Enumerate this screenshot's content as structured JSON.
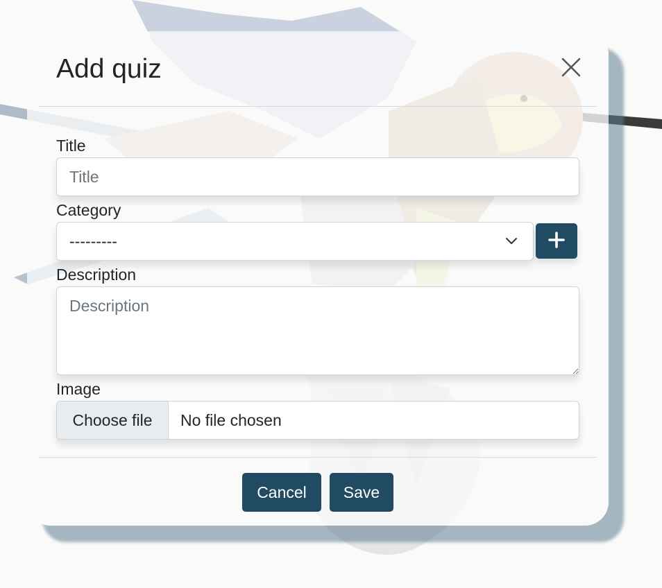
{
  "modal": {
    "title": "Add quiz"
  },
  "form": {
    "title_label": "Title",
    "title_placeholder": "Title",
    "category_label": "Category",
    "category_value": "---------",
    "description_label": "Description",
    "description_placeholder": "Description",
    "image_label": "Image",
    "file_button_label": "Choose file",
    "file_status": "No file chosen"
  },
  "footer": {
    "cancel_label": "Cancel",
    "save_label": "Save"
  },
  "icons": {
    "close": "close-icon",
    "chevron": "chevron-down-icon",
    "add": "plus-icon"
  },
  "colors": {
    "primary": "#214a63",
    "modal_shadow": "#5d7d91"
  }
}
